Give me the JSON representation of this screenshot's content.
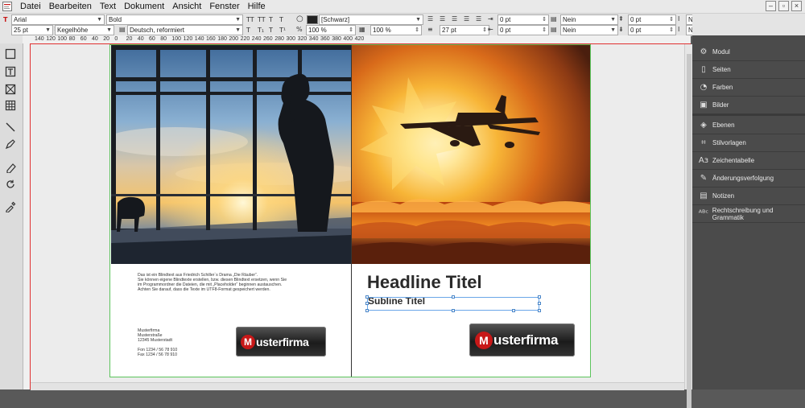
{
  "menu": [
    "Datei",
    "Bearbeiten",
    "Text",
    "Dokument",
    "Ansicht",
    "Fenster",
    "Hilfe"
  ],
  "toolbar": {
    "font_family": "Arial",
    "font_style": "Bold",
    "font_size": "25 pt",
    "leading": "Kegelhöhe",
    "language": "Deutsch, reformiert",
    "color_name": "[Schwarz]",
    "tint": "100 %",
    "opacity": "100 %",
    "indent_left": "0 pt",
    "indent_right": "0 pt",
    "space_before": "0 pt",
    "space_after": "0 pt",
    "baseline": "27 pt",
    "dropcap": "Nein",
    "dropcap2": "Nein",
    "hyphen": "Nein",
    "hyphen2": "Nein",
    "char_small_t": "T",
    "char_caps": "TT",
    "char_sup": "T¹",
    "char_sub": "T₁",
    "char_under": "T",
    "char_strike": "T",
    "percent": "%"
  },
  "ruler": [
    "140",
    "120",
    "100",
    "80",
    "60",
    "40",
    "20",
    "0",
    "20",
    "40",
    "60",
    "80",
    "100",
    "120",
    "140",
    "160",
    "180",
    "200",
    "220",
    "240",
    "260",
    "280",
    "300",
    "320",
    "340",
    "360",
    "380",
    "400",
    "420"
  ],
  "tools": [
    "rectangle-frame-icon",
    "text-frame-icon",
    "image-frame-icon",
    "table-icon",
    "line-icon",
    "pen-icon",
    "eraser-icon",
    "rotate-icon",
    "eyedropper-icon"
  ],
  "left_page": {
    "body_text": [
      "Das ist ein Blindtext aus Friedrich Schiller`s Drama „Die Räuber“.",
      "Sie können eigene Blindtexte erstellen, bzw. diesen Blindtext ersetzen, wenn Sie",
      "im Programmordner die Dateien, die mit „Placeholder“ beginnen austauschen.",
      "Achten Sie darauf, dass die Texte im UTF8-Format gespeichert werden."
    ],
    "address": [
      "Musterfirma",
      "Musterstraße",
      "12345 Musterstadt",
      "",
      "Fon 1234 / 56 78 910",
      "Fax 1234 / 56 78 910"
    ],
    "logo_letter": "M",
    "logo_text": "usterfirma"
  },
  "right_page": {
    "headline": "Headline Titel",
    "subline": "Subline Titel",
    "logo_letter": "M",
    "logo_text": "usterfirma"
  },
  "panel": {
    "items": [
      {
        "icon": "gear-icon",
        "label": "Modul"
      },
      {
        "icon": "pages-icon",
        "label": "Seiten"
      },
      {
        "icon": "palette-icon",
        "label": "Farben"
      },
      {
        "icon": "image-icon",
        "label": "Bilder"
      },
      {
        "icon": "layers-icon",
        "label": "Ebenen"
      },
      {
        "icon": "styles-icon",
        "label": "Stilvorlagen"
      },
      {
        "icon": "charmap-icon",
        "label": "Zeichentabelle"
      },
      {
        "icon": "track-changes-icon",
        "label": "Änderungsverfolgung"
      },
      {
        "icon": "notes-icon",
        "label": "Notizen"
      },
      {
        "icon": "spellcheck-icon",
        "label": "Rechtschreibung und Grammatik"
      }
    ]
  },
  "colors": {
    "accent_red": "#c81818",
    "panel_bg": "#4b4b4b",
    "selection": "#6aa6e8",
    "page_border": "#5cc45c"
  }
}
